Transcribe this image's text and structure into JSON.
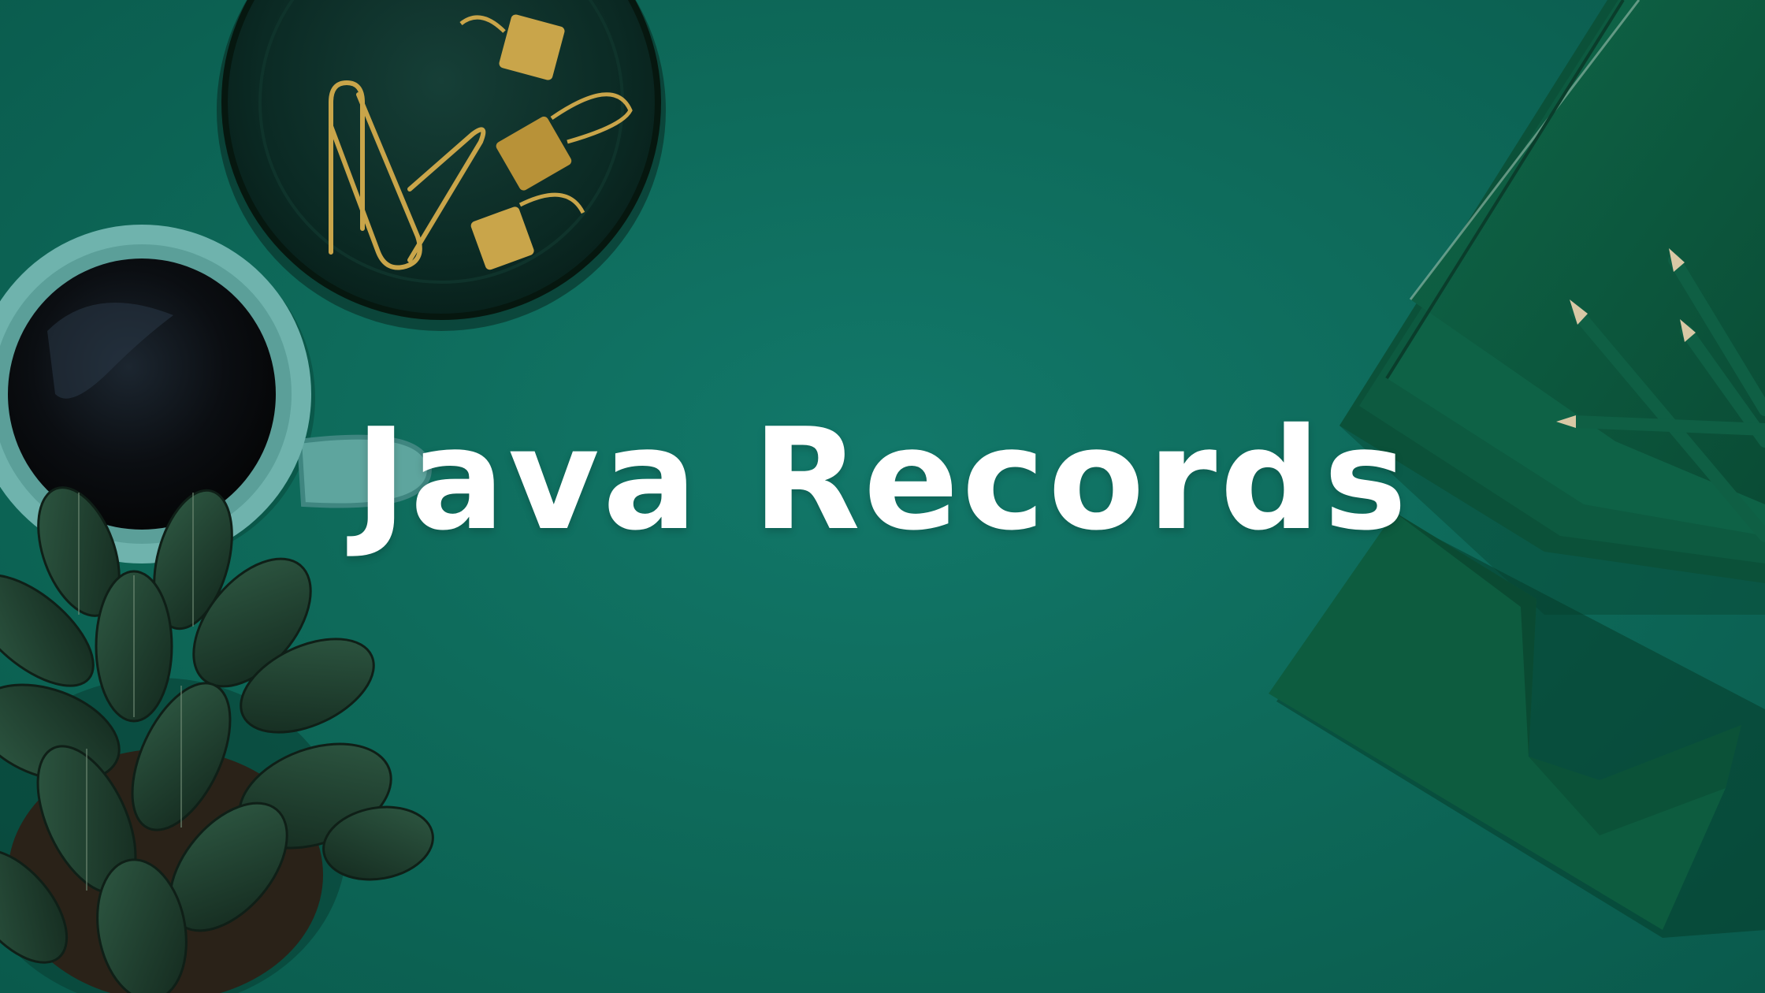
{
  "headline": {
    "title": "Java Records"
  },
  "colors": {
    "background": "#0e6b5b",
    "title_text": "#ffffff",
    "plant_leaf": "#1f3a2c",
    "mug": "#6fb3ad",
    "coffee": "#0b0e12",
    "tray": "#0b2a24",
    "clip_gold": "#c9a54a",
    "notebook": "#0d5a41",
    "pencil": "#0f5f44",
    "paper_tray": "#0d5c3f"
  },
  "objects": [
    {
      "name": "coffee-mug",
      "icon": "mug-icon"
    },
    {
      "name": "paperclip-tray",
      "icon": "tray-icon"
    },
    {
      "name": "potted-plant",
      "icon": "plant-icon"
    },
    {
      "name": "notebook-stack",
      "icon": "notebook-icon"
    },
    {
      "name": "pencils",
      "icon": "pencil-icon"
    },
    {
      "name": "paper-tray",
      "icon": "tray-icon"
    }
  ]
}
